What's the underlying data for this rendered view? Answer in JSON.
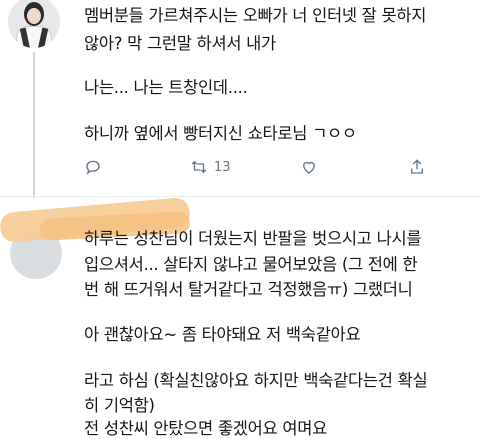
{
  "tweet1": {
    "lines": [
      "멤버분들 가르쳐주시는 오빠가 너 인터넷 잘 못하지",
      "않아? 막 그런말 하셔서 내가",
      "나는... 나는 트창인데....",
      "하니까 옆에서 빵터지신 쇼타로님 ㄱㅇㅇ"
    ],
    "actions": {
      "reply_icon": "reply-icon",
      "retweet_icon": "retweet-icon",
      "retweet_count": "13",
      "like_icon": "like-icon",
      "share_icon": "share-icon"
    }
  },
  "tweet2": {
    "header_redacted": "",
    "lines": [
      "하루는 성찬님이 더웠는지 반팔을 벗으시고 나시를",
      "입으셔서... 살타지 않냐고 물어보았음 (그 전에 한",
      "번 해 뜨거워서 탈거같다고 걱정했음ㅠ) 그랬더니",
      "아 괜찮아요~ 좀 타야돼요 저 백숙같아요",
      "라고 하심 (확실친않아요 하지만 백숙같다는건 확실",
      "히 기억함)",
      "전 성찬씨 안탔으면 좋겠어요 여며요"
    ]
  },
  "colors": {
    "text": "#14171a",
    "muted": "#657786",
    "thread_line": "#ccd6dd",
    "redaction": "#f7cc96"
  }
}
